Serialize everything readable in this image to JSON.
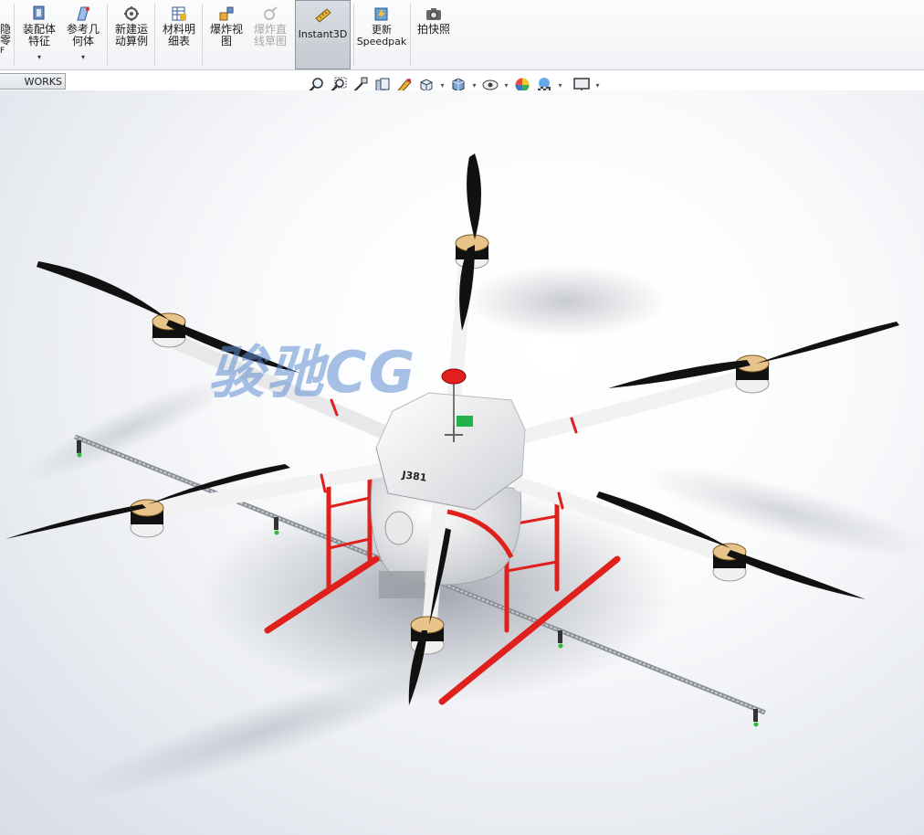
{
  "ribbon": {
    "partial_left": {
      "line1": "隐",
      "line2": "零",
      "line3": "F"
    },
    "buttons": [
      {
        "label": "装配体\n特征",
        "dropdown": "▾",
        "icon": "assembly-feature-icon"
      },
      {
        "label": "参考几\n何体",
        "dropdown": "▾",
        "icon": "reference-geometry-icon"
      },
      {
        "label": "新建运\n动算例",
        "icon": "motion-study-icon"
      },
      {
        "label": "材料明\n细表",
        "icon": "bom-icon"
      },
      {
        "label": "爆炸视\n图",
        "icon": "exploded-view-icon"
      },
      {
        "label": "爆炸直\n线草图",
        "icon": "explode-line-sketch-icon",
        "disabled": true
      },
      {
        "label": "Instant3D",
        "icon": "instant3d-icon",
        "active": true
      },
      {
        "label": "更新\nSpeedpak",
        "icon": "speedpak-icon"
      },
      {
        "label": "拍快照",
        "icon": "camera-icon"
      }
    ]
  },
  "tab_label": "WORKS MBD",
  "heads_up_toolbar": [
    "zoom-to-fit-icon",
    "zoom-to-area-icon",
    "previous-view-icon",
    "section-view-icon",
    "dynamic-annotation-icon",
    "view-orientation-icon",
    "display-style-icon",
    "hide-show-icon",
    "edit-appearance-icon",
    "apply-scene-icon",
    "view-settings-icon"
  ],
  "watermark": "骏驰CG",
  "colors": {
    "accent_red": "#e0201c",
    "propeller": "#111111",
    "body": "#f4f4f4"
  }
}
